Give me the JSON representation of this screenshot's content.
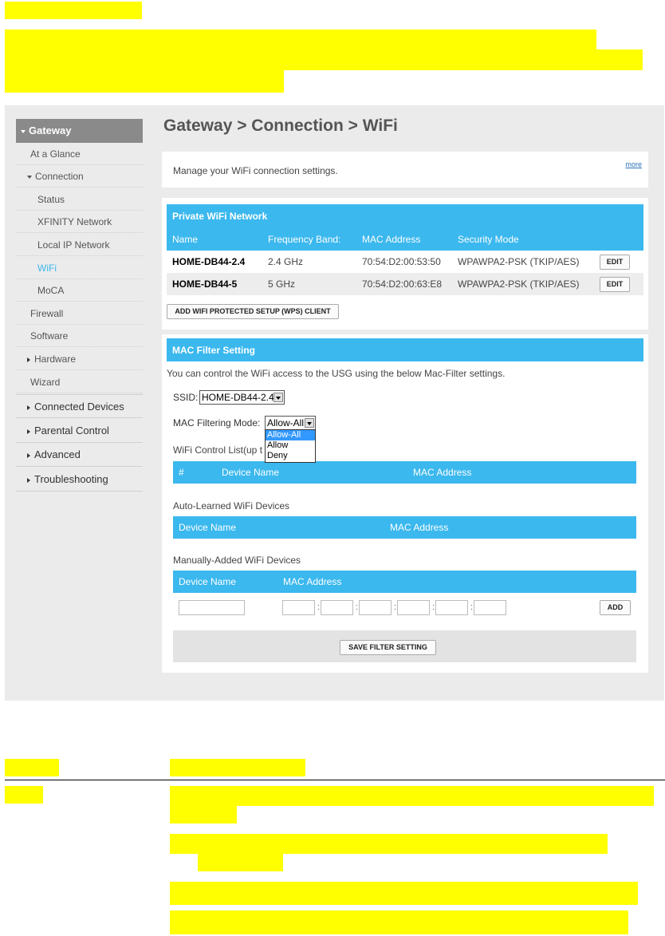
{
  "app": {
    "breadcrumb": "Gateway > Connection > WiFi"
  },
  "sidebar": {
    "header": "Gateway",
    "items": [
      {
        "label": "At a Glance"
      },
      {
        "label": "Connection"
      },
      {
        "label": "Status"
      },
      {
        "label": "XFINITY Network"
      },
      {
        "label": "Local IP Network"
      },
      {
        "label": "WiFi"
      },
      {
        "label": "MoCA"
      },
      {
        "label": "Firewall"
      },
      {
        "label": "Software"
      },
      {
        "label": "Hardware"
      },
      {
        "label": "Wizard"
      }
    ],
    "main": [
      {
        "label": "Connected Devices"
      },
      {
        "label": "Parental Control"
      },
      {
        "label": "Advanced"
      },
      {
        "label": "Troubleshooting"
      }
    ]
  },
  "intro": {
    "text": "Manage your WiFi connection settings.",
    "more": "more"
  },
  "private": {
    "title": "Private WiFi Network",
    "headers": [
      "Name",
      "Frequency Band:",
      "MAC Address",
      "Security Mode"
    ],
    "rows": [
      {
        "name": "HOME-DB44-2.4",
        "band": "2.4 GHz",
        "mac": "70:54:D2:00:53:50",
        "mode": "WPAWPA2-PSK (TKIP/AES)",
        "edit": "EDIT"
      },
      {
        "name": "HOME-DB44-5",
        "band": "5 GHz",
        "mac": "70:54:D2:00:63:E8",
        "mode": "WPAWPA2-PSK (TKIP/AES)",
        "edit": "EDIT"
      }
    ],
    "wps_button": "ADD WIFI PROTECTED SETUP (WPS) CLIENT"
  },
  "mac": {
    "title": "MAC Filter Setting",
    "desc": "You can control the WiFi access to the USG using the below Mac-Filter settings.",
    "ssid_label": "SSID:",
    "ssid_value": "HOME-DB44-2.4",
    "mode_label": "MAC Filtering Mode:",
    "mode_value": "Allow-All",
    "mode_options": [
      "Allow-All",
      "Allow",
      "Deny"
    ],
    "control_list_label": "WiFi Control List(up t",
    "control_headers": [
      "#",
      "Device Name",
      "MAC Address"
    ],
    "auto_label": "Auto-Learned WiFi Devices",
    "auto_headers": [
      "Device Name",
      "MAC Address"
    ],
    "manual_label": "Manually-Added WiFi Devices",
    "manual_headers": [
      "Device Name",
      "MAC Address"
    ],
    "add_button": "ADD",
    "save_button": "SAVE FILTER SETTING"
  },
  "colors": {
    "accent": "#3bb8ee",
    "highlight": "#ffff00",
    "sidebar_header": "#8a8a8a",
    "active_link": "#3bb8ee"
  }
}
